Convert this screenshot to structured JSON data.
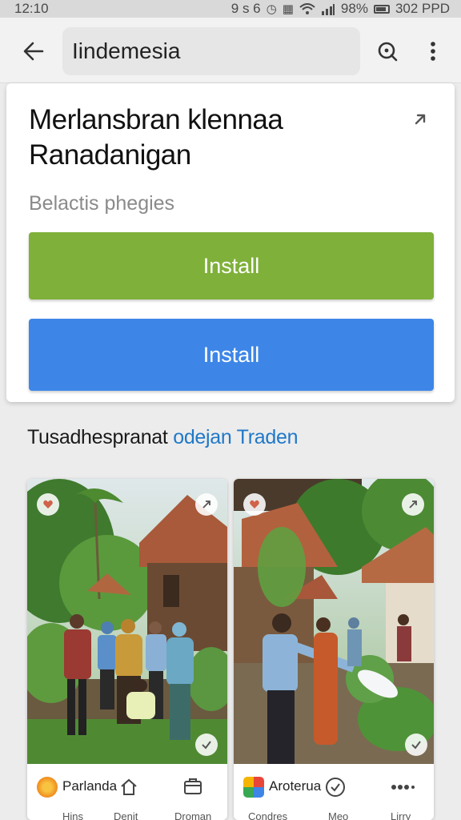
{
  "status_bar": {
    "time": "12:10",
    "icons_text": "9 s 6",
    "battery_percent": "98%",
    "carrier": "302 PPD"
  },
  "app_bar": {
    "search_value": "Iindemesia",
    "back_icon": "arrow-left-icon",
    "search_icon": "search-icon",
    "more_icon": "more-vertical-icon"
  },
  "app_card": {
    "title_line1": "Merlansbran klennaa",
    "title_line2": "Ranadanigan",
    "subtitle": "Belactis phegies",
    "install_primary": "Install",
    "install_secondary": "Install",
    "share_icon": "share-arrow-icon"
  },
  "section": {
    "heading": "Tusadhespranat",
    "link": "odejan Traden"
  },
  "screenshots": [
    {
      "name": "Parlanda",
      "labels": [
        "Hins",
        "Denit",
        "Droman"
      ]
    },
    {
      "name": "Aroterua",
      "labels": [
        "Condres",
        "Meo",
        "Lirry"
      ]
    }
  ],
  "colors": {
    "install_green": "#7fb03a",
    "install_blue": "#3d86e8",
    "link_blue": "#1f78c8"
  }
}
